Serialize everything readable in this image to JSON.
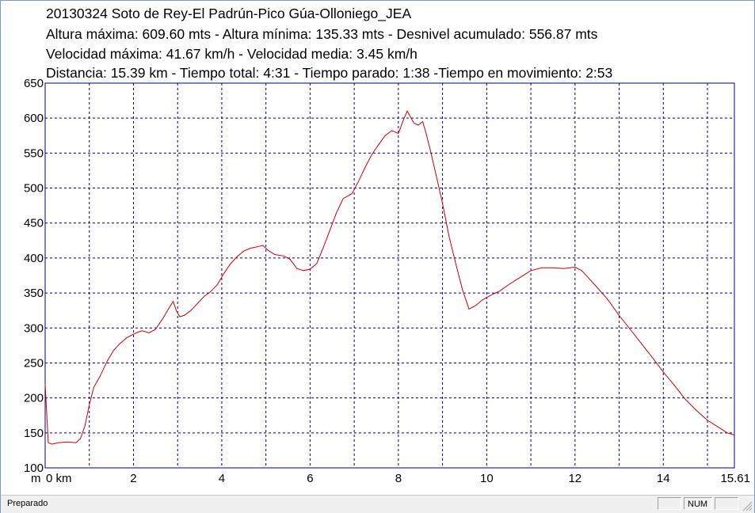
{
  "header": {
    "title": "20130324 Soto de Rey-El Padrún-Pico Gúa-Olloniego_JEA",
    "line2": "Altura máxima: 609.60 mts - Altura mínima: 135.33 mts - Desnivel acumulado: 556.87 mts",
    "line3": "Velocidad máxima: 41.67 km/h - Velocidad media: 3.45 km/h",
    "line4": "Distancia: 15.39 km - Tiempo total: 4:31 - Tiempo parado: 1:38 -Tiempo en movimiento: 2:53"
  },
  "statusbar": {
    "text": "Preparado",
    "num_label": "NUM"
  },
  "colors": {
    "line": "#cc0000",
    "grid": "#000080",
    "frame": "#000080"
  },
  "chart_data": {
    "type": "line",
    "xlabel": "m",
    "ylim": [
      100,
      650
    ],
    "xlim": [
      0,
      15.61
    ],
    "yticks": [
      100,
      150,
      200,
      250,
      300,
      350,
      400,
      450,
      500,
      550,
      600,
      650
    ],
    "xticks": [
      0,
      2,
      4,
      6,
      8,
      10,
      12,
      14,
      15.61
    ],
    "xtick_labels": [
      "0 km",
      "2",
      "4",
      "6",
      "8",
      "10",
      "12",
      "14",
      "15.61"
    ],
    "grid": true,
    "series": [
      {
        "x": [
          0.0,
          0.07,
          0.15,
          0.3,
          0.5,
          0.7,
          0.8,
          0.9,
          1.0,
          1.1,
          1.25,
          1.4,
          1.55,
          1.7,
          1.85,
          2.0,
          2.1,
          2.2,
          2.35,
          2.5,
          2.65,
          2.8,
          2.9,
          2.97,
          3.05,
          3.15,
          3.3,
          3.45,
          3.6,
          3.75,
          3.9,
          4.05,
          4.2,
          4.35,
          4.5,
          4.65,
          4.8,
          4.93,
          5.05,
          5.2,
          5.4,
          5.55,
          5.7,
          5.85,
          6.0,
          6.15,
          6.3,
          6.45,
          6.6,
          6.75,
          6.95,
          7.1,
          7.25,
          7.4,
          7.55,
          7.7,
          7.85,
          8.0,
          8.1,
          8.2,
          8.27,
          8.35,
          8.45,
          8.55,
          8.62,
          8.72,
          8.85,
          9.0,
          9.15,
          9.3,
          9.45,
          9.6,
          9.75,
          9.9,
          10.1,
          10.3,
          10.5,
          10.75,
          11.0,
          11.25,
          11.5,
          11.75,
          12.0,
          12.15,
          12.3,
          12.5,
          12.75,
          13.0,
          13.25,
          13.5,
          13.75,
          14.0,
          14.25,
          14.5,
          14.75,
          15.0,
          15.25,
          15.45,
          15.61
        ],
        "values": [
          220,
          136,
          134,
          136,
          137,
          136,
          142,
          160,
          190,
          215,
          232,
          252,
          268,
          278,
          286,
          291,
          294,
          296,
          293,
          298,
          312,
          328,
          338,
          325,
          316,
          318,
          325,
          335,
          345,
          352,
          362,
          378,
          392,
          402,
          410,
          414,
          416,
          418,
          411,
          405,
          403,
          398,
          385,
          382,
          384,
          392,
          415,
          440,
          465,
          485,
          492,
          510,
          530,
          548,
          562,
          575,
          582,
          578,
          595,
          610,
          602,
          593,
          590,
          595,
          580,
          555,
          520,
          478,
          430,
          392,
          355,
          327,
          332,
          340,
          347,
          353,
          362,
          372,
          382,
          386,
          386,
          385,
          387,
          382,
          372,
          358,
          340,
          318,
          298,
          278,
          258,
          237,
          218,
          198,
          182,
          168,
          158,
          150,
          147
        ]
      }
    ]
  }
}
